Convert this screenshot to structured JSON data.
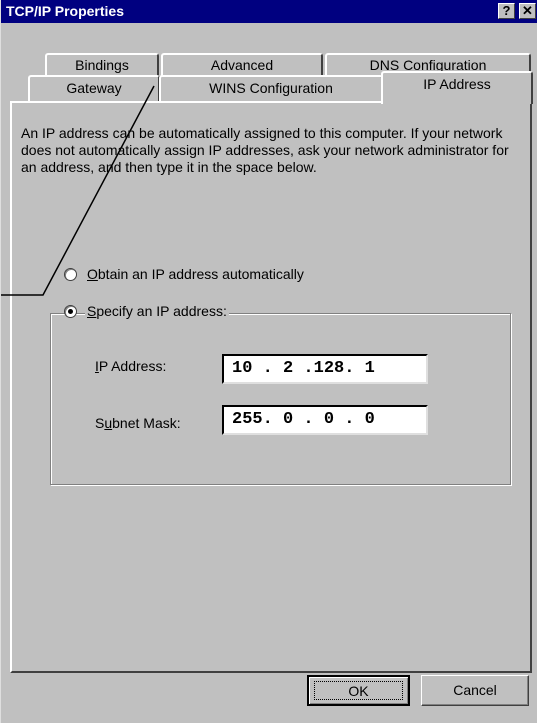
{
  "window": {
    "title": "TCP/IP Properties",
    "help_button": "?",
    "close_button": "✕"
  },
  "tabs": {
    "row_back": [
      "Bindings",
      "Advanced",
      "DNS Configuration"
    ],
    "row_front": [
      "Gateway",
      "WINS Configuration",
      "IP Address"
    ],
    "active": "IP Address"
  },
  "description": "An IP address can be automatically assigned to this computer. If your network does not automatically assign IP addresses, ask your network administrator for an address, and then type it in the space below.",
  "options": {
    "obtain_rest": "btain an IP address automatically",
    "obtain_key": "O",
    "specify_rest": "pecify an IP address:",
    "specify_key": "S",
    "selected": "specify"
  },
  "fields": {
    "ip_label_key": "I",
    "ip_label_rest": "P Address:",
    "ip_value": "10 . 2 .128. 1",
    "subnet_label_pre": "S",
    "subnet_label_key": "u",
    "subnet_label_rest": "bnet Mask:",
    "subnet_value": "255. 0 . 0 . 0"
  },
  "buttons": {
    "ok": "OK",
    "cancel": "Cancel"
  }
}
